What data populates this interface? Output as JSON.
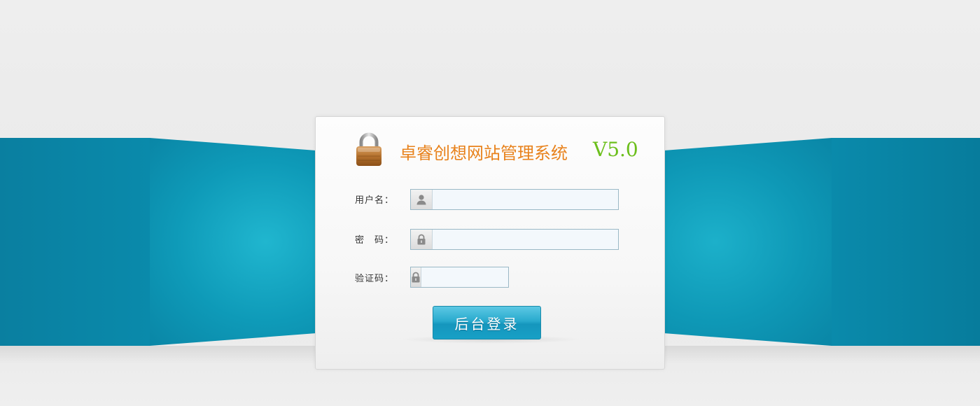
{
  "login": {
    "title": "卓睿创想网站管理系统",
    "version": "V5.0",
    "username_label": "用户名：",
    "password_label": "密　码：",
    "captcha_label": "验证码：",
    "username_value": "",
    "password_value": "",
    "captcha_value": "",
    "submit_label": "后台登录"
  },
  "icons": {
    "logo": "padlock-icon",
    "username": "user-icon",
    "password": "lock-icon",
    "captcha": "lock-icon"
  },
  "colors": {
    "title": "#e8821c",
    "version": "#6cbf1c",
    "band": "#0a86a6",
    "button": "#1596bd"
  }
}
